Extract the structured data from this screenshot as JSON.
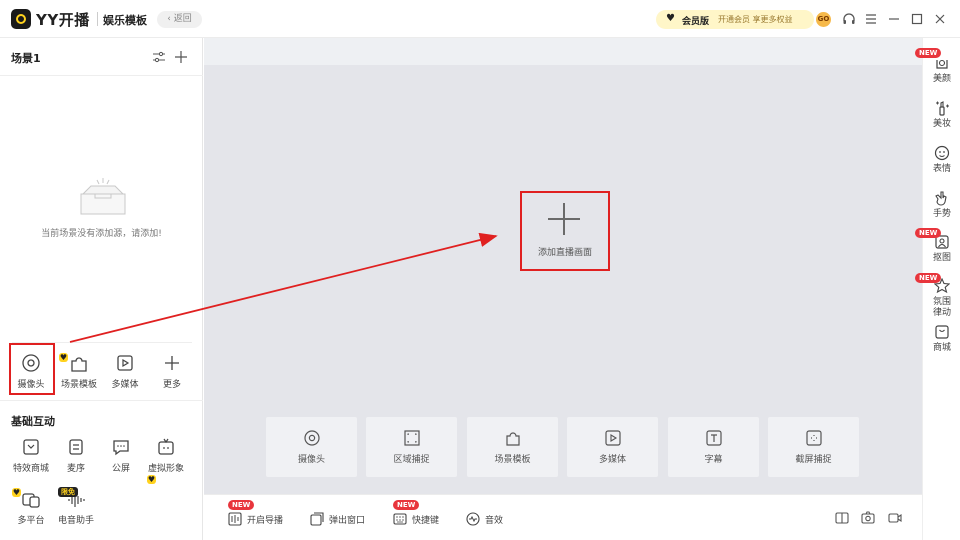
{
  "titlebar": {
    "app_name": "YY开播",
    "mode_title": "娱乐模板",
    "back_label": "‹ 返回",
    "vip_name": "会员版",
    "vip_desc": "开通会员 享更多权益",
    "vip_badge": "GO"
  },
  "left": {
    "scene_title": "场景1",
    "empty_text": "当前场景没有添加源，请添加!",
    "sources": [
      {
        "label": "摄像头",
        "icon": "camera-icon"
      },
      {
        "label": "场景模板",
        "icon": "puzzle-icon"
      },
      {
        "label": "多媒体",
        "icon": "media-icon"
      },
      {
        "label": "更多",
        "icon": "plus-icon"
      }
    ],
    "section_title": "基础互动",
    "features": [
      {
        "label": "特效商城",
        "icon": "gift-shop-icon"
      },
      {
        "label": "麦序",
        "icon": "queue-icon"
      },
      {
        "label": "公屏",
        "icon": "chat-icon"
      },
      {
        "label": "虚拟形象",
        "icon": "avatar-icon"
      },
      {
        "label": "多平台",
        "icon": "multi-platform-icon"
      },
      {
        "label": "电音助手",
        "icon": "voice-assistant-icon"
      }
    ],
    "hot_tag": "限免"
  },
  "canvas": {
    "add_live_label": "添加直播画面",
    "tiles": [
      {
        "label": "摄像头",
        "icon": "camera-icon"
      },
      {
        "label": "区域捕捉",
        "icon": "region-capture-icon"
      },
      {
        "label": "场景模板",
        "icon": "puzzle-icon"
      },
      {
        "label": "多媒体",
        "icon": "media-icon"
      },
      {
        "label": "字幕",
        "icon": "text-icon"
      },
      {
        "label": "截屏捕捉",
        "icon": "screen-capture-icon"
      }
    ]
  },
  "bottombar": {
    "items": [
      {
        "label": "开启导播",
        "icon": "director-icon",
        "new": true
      },
      {
        "label": "弹出窗口",
        "icon": "popup-window-icon",
        "new": false
      },
      {
        "label": "快捷键",
        "icon": "keyboard-icon",
        "new": true
      },
      {
        "label": "音效",
        "icon": "sound-effect-icon",
        "new": false
      }
    ],
    "new_label": "NEW"
  },
  "right": {
    "items": [
      {
        "label": "美颜",
        "icon": "beauty-icon",
        "new": true
      },
      {
        "label": "美妆",
        "icon": "makeup-icon",
        "new": false
      },
      {
        "label": "表情",
        "icon": "emoji-icon",
        "new": false
      },
      {
        "label": "手势",
        "icon": "gesture-icon",
        "new": false
      },
      {
        "label": "抠图",
        "icon": "matting-icon",
        "new": true
      },
      {
        "label": "氛围\n律动",
        "icon": "ambience-icon",
        "new": true
      },
      {
        "label": "商城",
        "icon": "shop-icon",
        "new": false
      }
    ]
  },
  "colors": {
    "accent_yellow": "#ffd21e",
    "highlight_red": "#e02020",
    "new_badge_red": "#e8353c",
    "stage_bg": "#e4e5ea"
  }
}
